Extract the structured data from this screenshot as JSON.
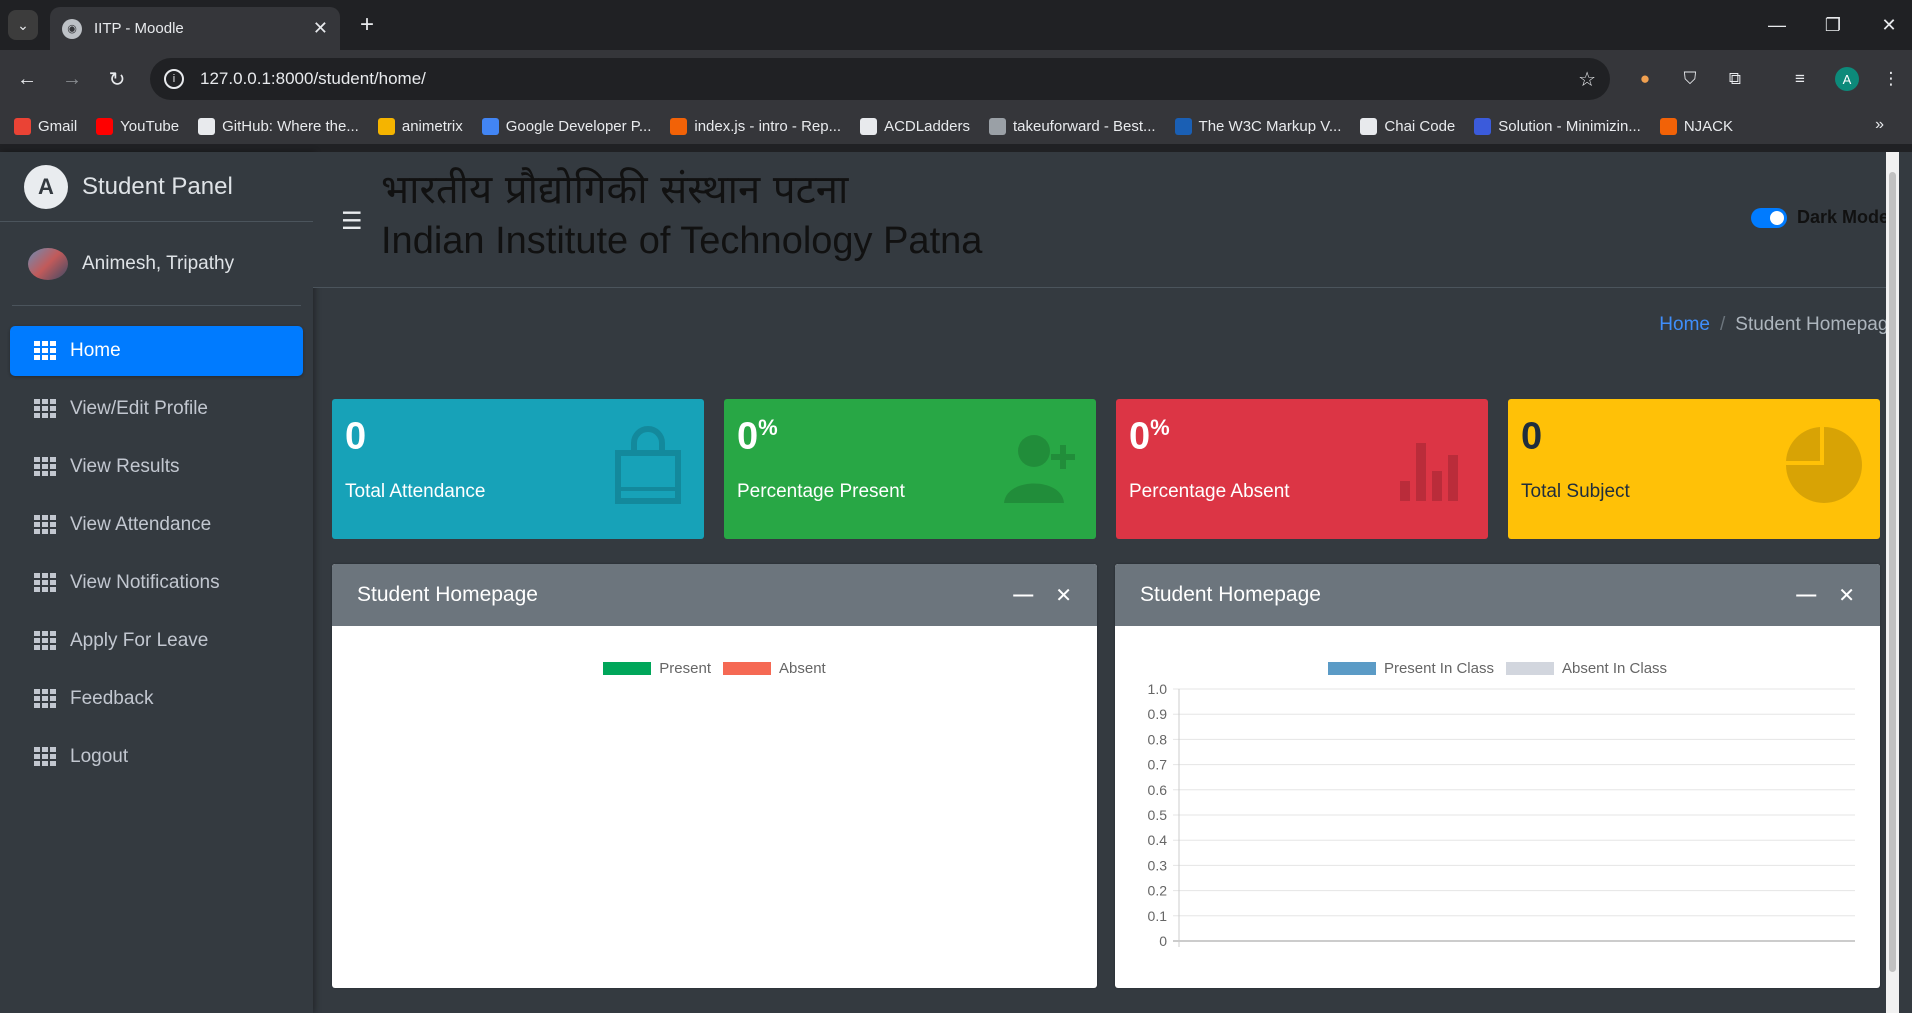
{
  "browser": {
    "tab_title": "IITP - Moodle",
    "url": "127.0.0.1:8000/student/home/",
    "profile_initial": "A",
    "bookmarks": [
      {
        "label": "Gmail",
        "color": "#ea4335"
      },
      {
        "label": "YouTube",
        "color": "#ff0000"
      },
      {
        "label": "GitHub: Where the...",
        "color": "#e8eaed"
      },
      {
        "label": "animetrix",
        "color": "#f5b400"
      },
      {
        "label": "Google Developer P...",
        "color": "#4285f4"
      },
      {
        "label": "index.js - intro - Rep...",
        "color": "#f26207"
      },
      {
        "label": "ACDLadders",
        "color": "#e8eaed"
      },
      {
        "label": "takeuforward - Best...",
        "color": "#9aa0a6"
      },
      {
        "label": "The W3C Markup V...",
        "color": "#1a5fb4"
      },
      {
        "label": "Chai Code",
        "color": "#e8eaed"
      },
      {
        "label": "Solution - Minimizin...",
        "color": "#3b5bdb"
      },
      {
        "label": "NJACK",
        "color": "#f26207"
      }
    ]
  },
  "sidebar": {
    "brand": "Student Panel",
    "brand_logo": "A",
    "user": "Animesh, Tripathy",
    "items": [
      {
        "label": "Home",
        "active": true
      },
      {
        "label": "View/Edit Profile",
        "active": false
      },
      {
        "label": "View Results",
        "active": false
      },
      {
        "label": "View Attendance",
        "active": false
      },
      {
        "label": "View Notifications",
        "active": false
      },
      {
        "label": "Apply For Leave",
        "active": false
      },
      {
        "label": "Feedback",
        "active": false
      },
      {
        "label": "Logout",
        "active": false
      }
    ]
  },
  "header": {
    "title_hindi": "भारतीय प्रौद्योगिकी संस्थान पटना",
    "title_english": "Indian Institute of Technology Patna",
    "dark_mode_label": "Dark Mode",
    "dark_mode_on": true
  },
  "breadcrumb": {
    "home": "Home",
    "current": "Student Homepage"
  },
  "stats": [
    {
      "value": "0",
      "unit": "",
      "label": "Total Attendance",
      "color": "#17a2b8",
      "icon": "shopping-bag-icon"
    },
    {
      "value": "0",
      "unit": "%",
      "label": "Percentage Present",
      "color": "#28a745",
      "icon": "user-plus-icon"
    },
    {
      "value": "0",
      "unit": "%",
      "label": "Percentage Absent",
      "color": "#dc3545",
      "icon": "bar-chart-icon"
    },
    {
      "value": "0",
      "unit": "",
      "label": "Total Subject",
      "color": "#ffc107",
      "icon": "pie-chart-icon"
    }
  ],
  "cards": [
    {
      "title": "Student Homepage",
      "legend": [
        {
          "label": "Present",
          "color": "#00a65a"
        },
        {
          "label": "Absent",
          "color": "#f56954"
        }
      ]
    },
    {
      "title": "Student Homepage",
      "legend": [
        {
          "label": "Present In Class",
          "color": "#5b9bc6"
        },
        {
          "label": "Absent In Class",
          "color": "#d2d6de"
        }
      ]
    }
  ],
  "chart_data": {
    "type": "bar",
    "categories": [],
    "series": [
      {
        "name": "Present In Class",
        "values": []
      },
      {
        "name": "Absent In Class",
        "values": []
      }
    ],
    "ylim": [
      0,
      1.0
    ],
    "yticks": [
      "1.0",
      "0.9",
      "0.8",
      "0.7",
      "0.6",
      "0.5",
      "0.4",
      "0.3",
      "0.2",
      "0.1",
      "0"
    ],
    "grid": true,
    "legend": "top"
  }
}
